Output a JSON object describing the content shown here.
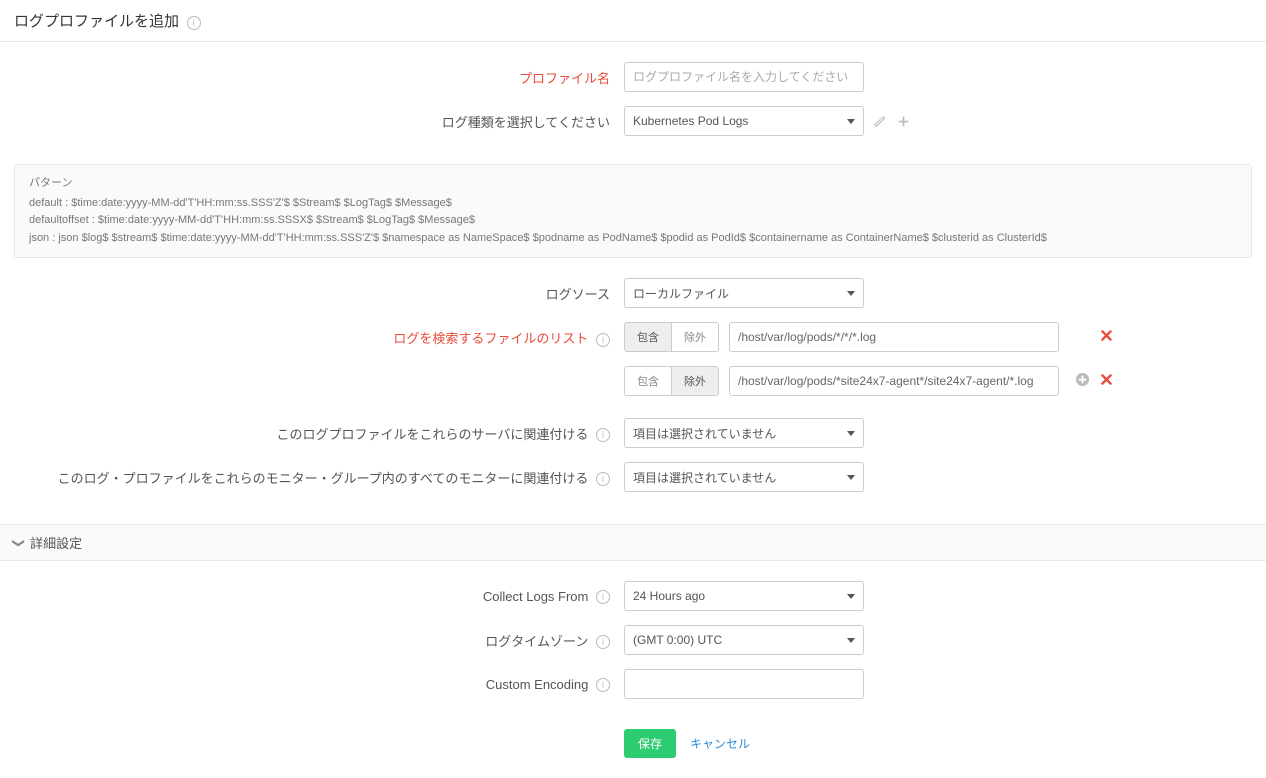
{
  "header": {
    "title": "ログプロファイルを追加"
  },
  "fields": {
    "profile_name": {
      "label": "プロファイル名",
      "placeholder": "ログプロファイル名を入力してください",
      "value": ""
    },
    "log_type": {
      "label": "ログ種類を選択してください",
      "selected": "Kubernetes Pod Logs"
    },
    "log_source": {
      "label": "ログソース",
      "selected": "ローカルファイル"
    },
    "file_list": {
      "label": "ログを検索するファイルのリスト"
    },
    "assoc_servers": {
      "label": "このログプロファイルをこれらのサーバに関連付ける",
      "selected": "項目は選択されていません"
    },
    "assoc_groups": {
      "label": "このログ・プロファイルをこれらのモニター・グループ内のすべてのモニターに関連付ける",
      "selected": "項目は選択されていません"
    },
    "collect_from": {
      "label": "Collect Logs From",
      "selected": "24 Hours ago"
    },
    "timezone": {
      "label": "ログタイムゾーン",
      "selected": "(GMT 0:00) UTC"
    },
    "encoding": {
      "label": "Custom Encoding",
      "value": ""
    }
  },
  "toggles": {
    "include": "包含",
    "exclude": "除外"
  },
  "file_rows": [
    {
      "path": "/host/var/log/pods/*/*/*.log",
      "mode": "include",
      "show_add": false
    },
    {
      "path": "/host/var/log/pods/*site24x7-agent*/site24x7-agent/*.log",
      "mode": "exclude",
      "show_add": true
    }
  ],
  "pattern_box": {
    "title": "パターン",
    "lines": [
      "default : $time:date:yyyy-MM-dd'T'HH:mm:ss.SSS'Z'$ $Stream$ $LogTag$ $Message$",
      "defaultoffset : $time:date:yyyy-MM-dd'T'HH:mm:ss.SSSX$ $Stream$ $LogTag$ $Message$",
      "json : json $log$ $stream$ $time:date:yyyy-MM-dd'T'HH:mm:ss.SSS'Z'$ $namespace as NameSpace$ $podname as PodName$ $podid as PodId$ $containername as ContainerName$ $clusterid as ClusterId$"
    ]
  },
  "advanced_section": {
    "title": "詳細設定"
  },
  "actions": {
    "save": "保存",
    "cancel": "キャンセル"
  }
}
